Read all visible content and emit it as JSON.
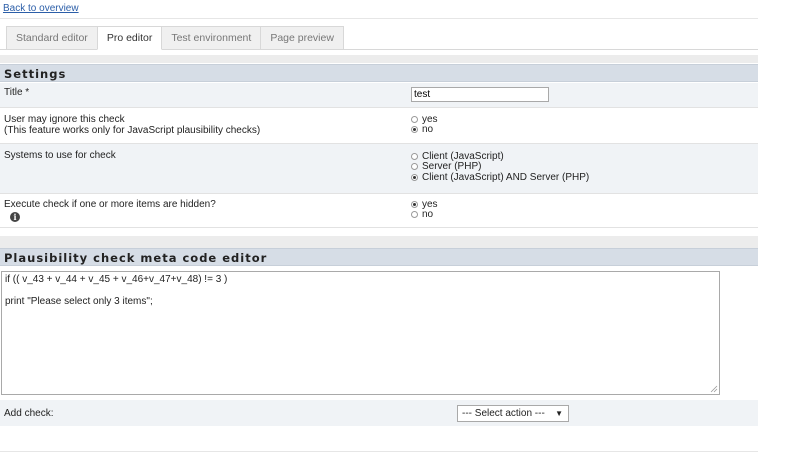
{
  "back_link": "Back to overview",
  "tabs": [
    {
      "label": "Standard editor",
      "active": false
    },
    {
      "label": "Pro editor",
      "active": true
    },
    {
      "label": "Test environment",
      "active": false
    },
    {
      "label": "Page preview",
      "active": false
    }
  ],
  "settings": {
    "heading": "Settings",
    "title_label": "Title *",
    "title_value": "test",
    "ignore_label_1": "User may ignore this check",
    "ignore_label_2": "(This feature works only for JavaScript plausibility checks)",
    "ignore_options": [
      "yes",
      "no"
    ],
    "ignore_selected": "no",
    "systems_label": "Systems to use for check",
    "systems_options": [
      "Client (JavaScript)",
      "Server (PHP)",
      "Client (JavaScript) AND Server (PHP)"
    ],
    "systems_selected": "Client (JavaScript) AND Server (PHP)",
    "hidden_label": "Execute check if one or more items are hidden?",
    "hidden_options": [
      "yes",
      "no"
    ],
    "hidden_selected": "yes"
  },
  "editor": {
    "heading": "Plausibility check meta code editor",
    "code_line_1": "if (( v_43 + v_44 + v_45 + v_46+v_47+v_48) != 3 )",
    "code_line_2": "print \"Please select only 3 items\";"
  },
  "add_check": {
    "label": "Add check:",
    "select_value": "--- Select action ---"
  },
  "icons": {
    "info": "info-icon",
    "dropdown": "chevron-down-icon"
  }
}
